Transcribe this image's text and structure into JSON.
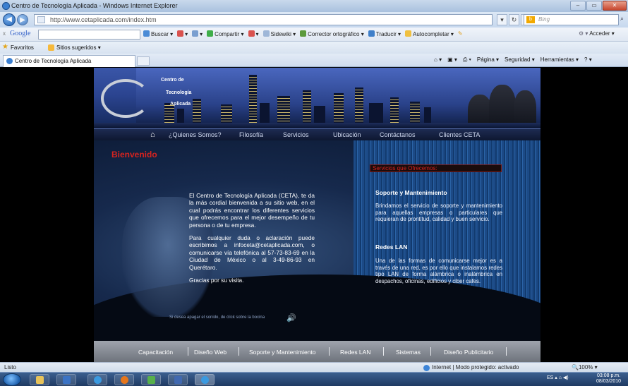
{
  "window": {
    "title": "Centro de Tecnología Aplicada - Windows Internet Explorer",
    "min_glyph": "–",
    "max_glyph": "▭",
    "close_glyph": "✕"
  },
  "addressbar": {
    "url": "http://www.cetaplicada.com/index.htm",
    "search_placeholder": "Bing",
    "search_glyph": "⌕",
    "back_glyph": "◀",
    "forward_glyph": "▶"
  },
  "google_toolbar": {
    "close": "x",
    "logo": "Google",
    "items": [
      "Buscar ▾",
      "▾",
      "▾",
      "Compartir ▾",
      "▾",
      "Sidewiki ▾",
      "Corrector ortográfico ▾",
      "Traducir ▾",
      "Autocompletar ▾"
    ],
    "acceder": "Acceder ▾"
  },
  "favorites_bar": {
    "favorites": "Favoritos",
    "suggested": "Sitios sugeridos ▾"
  },
  "tab": {
    "label": "Centro de Tecnología Aplicada"
  },
  "command_bar": [
    "▾",
    "▾",
    "▾",
    "Página ▾",
    "Seguridad ▾",
    "Herramientas ▾",
    "▾"
  ],
  "site": {
    "logo_lines": [
      "Centro de",
      "Tecnología",
      "Aplicada"
    ],
    "home_glyph": "⌂",
    "nav": [
      "¿Quienes Somos?",
      "Filosofía",
      "Servicios",
      "Ubicación",
      "Contáctanos",
      "Clientes CETA"
    ],
    "welcome_title": "Bienvenido",
    "intro_paragraphs": [
      "El Centro de Tecnología Aplicada (CETA), te da la más cordial bienvenida a su sitio web, en el cual podrás encontrar los diferentes servicios que ofrecemos para el mejor desempeño de tu persona o de tu empresa.",
      "Para cualquier duda o aclaración puede escribimos a infoceta@cetaplicada.com, o comunicarse vía telefónica al 57-73-83-69 en la Ciudad de México o al 3-49-86-93 en Querétaro.",
      "Gracias por su visita."
    ],
    "music_note": "Si desea apagar el sonido, de click sobre la bocina",
    "speaker_glyph": "🔊",
    "services_title": "Servicios que Ofrecemos:",
    "services": [
      {
        "title": "Soporte y Mantenimiento",
        "text": "Brindamos el servicio de soporte y mantenimiento para aquellas empresas o particulares que requieran de prontitud, calidad y buen servicio."
      },
      {
        "title": "Redes LAN",
        "text": "Una de las formas de comunicarse mejor es a través de una red, es por ello que instalamos redes tipo LAN de forma alámbrica o inalámbrica en despachos, oficinas, edificios y ciber cafes."
      }
    ],
    "footer_nav": [
      "Capacitación",
      "Diseño Web",
      "Soporte y Mantenimiento",
      "Redes LAN",
      "Sistemas",
      "Diseño Publicitario"
    ]
  },
  "statusbar": {
    "status": "Listo",
    "zone": "Internet | Modo protegido: activado",
    "zoom": "🔍100% ▾"
  },
  "taskbar": {
    "lang": "ES",
    "time": "03:08 p.m.",
    "date": "08/03/2010"
  },
  "colors": {
    "accent_red": "#d6231f",
    "ie_blue": "#3b7fd0"
  }
}
